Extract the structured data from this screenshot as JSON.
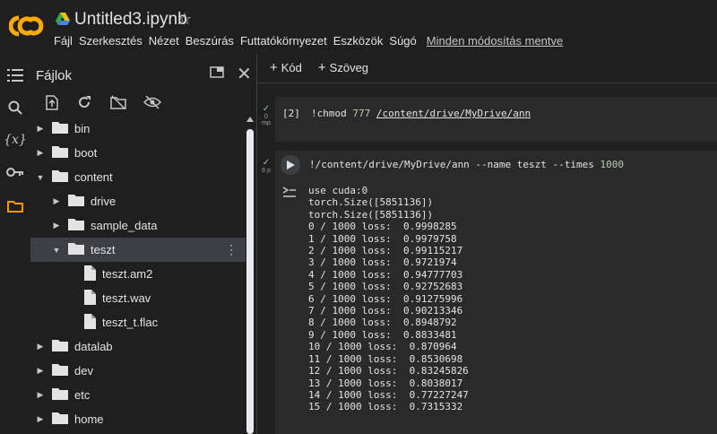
{
  "header": {
    "title": "Untitled3.ipynb",
    "menu": [
      "Fájl",
      "Szerkesztés",
      "Nézet",
      "Beszúrás",
      "Futtatókörnyezet",
      "Eszközök",
      "Súgó"
    ],
    "saved_status": "Minden módosítás mentve"
  },
  "files_panel": {
    "title": "Fájlok",
    "tree": [
      {
        "label": "bin",
        "type": "folder",
        "caret": "right",
        "depth": 0
      },
      {
        "label": "boot",
        "type": "folder",
        "caret": "right",
        "depth": 0
      },
      {
        "label": "content",
        "type": "folder",
        "caret": "down",
        "depth": 0
      },
      {
        "label": "drive",
        "type": "folder",
        "caret": "right",
        "depth": 1
      },
      {
        "label": "sample_data",
        "type": "folder",
        "caret": "right",
        "depth": 1
      },
      {
        "label": "teszt",
        "type": "folder",
        "caret": "down",
        "depth": 1,
        "selected": true
      },
      {
        "label": "teszt.am2",
        "type": "file",
        "depth": 2
      },
      {
        "label": "teszt.wav",
        "type": "file",
        "depth": 2
      },
      {
        "label": "teszt_t.flac",
        "type": "file",
        "depth": 2
      },
      {
        "label": "datalab",
        "type": "folder",
        "caret": "right",
        "depth": 0
      },
      {
        "label": "dev",
        "type": "folder",
        "caret": "right",
        "depth": 0
      },
      {
        "label": "etc",
        "type": "folder",
        "caret": "right",
        "depth": 0
      },
      {
        "label": "home",
        "type": "folder",
        "caret": "right",
        "depth": 0
      }
    ]
  },
  "toolbar": {
    "add_code": "Kód",
    "add_text": "Szöveg"
  },
  "cells": {
    "cell1": {
      "status_time": "0",
      "status_unit": "mp",
      "exec_count": "[2]",
      "cmd_prefix": "!chmod",
      "cmd_num": "777",
      "cmd_path": "/content/drive/MyDrive/ann"
    },
    "cell2": {
      "status_time": "6 p",
      "cmd_main": "!/content/drive/MyDrive/ann --name teszt --times",
      "cmd_num": "1000"
    }
  },
  "output": [
    "use cuda:0",
    "torch.Size([5851136])",
    "torch.Size([5851136])",
    "0 / 1000 loss:  0.9998285",
    "1 / 1000 loss:  0.9979758",
    "2 / 1000 loss:  0.99115217",
    "3 / 1000 loss:  0.9721974",
    "4 / 1000 loss:  0.94777703",
    "5 / 1000 loss:  0.92752683",
    "6 / 1000 loss:  0.91275996",
    "7 / 1000 loss:  0.90213346",
    "8 / 1000 loss:  0.8948792",
    "9 / 1000 loss:  0.8833481",
    "10 / 1000 loss:  0.870964",
    "11 / 1000 loss:  0.8530698",
    "12 / 1000 loss:  0.83245826",
    "13 / 1000 loss:  0.8038017",
    "14 / 1000 loss:  0.77227247",
    "15 / 1000 loss:  0.7315332"
  ],
  "colors": {
    "background": "#1f1f1f",
    "cell_bg": "#2a2a2a",
    "accent_orange": "#f29900",
    "success_green": "#81c995"
  },
  "icons": [
    "colab-logo",
    "drive-icon",
    "star-icon",
    "toc-icon",
    "search-icon",
    "variables-icon",
    "key-icon",
    "folder-icon",
    "upload-icon",
    "refresh-icon",
    "drive-off-icon",
    "hide-icon",
    "close-icon",
    "maximize-icon",
    "play-icon",
    "output-icon"
  ]
}
